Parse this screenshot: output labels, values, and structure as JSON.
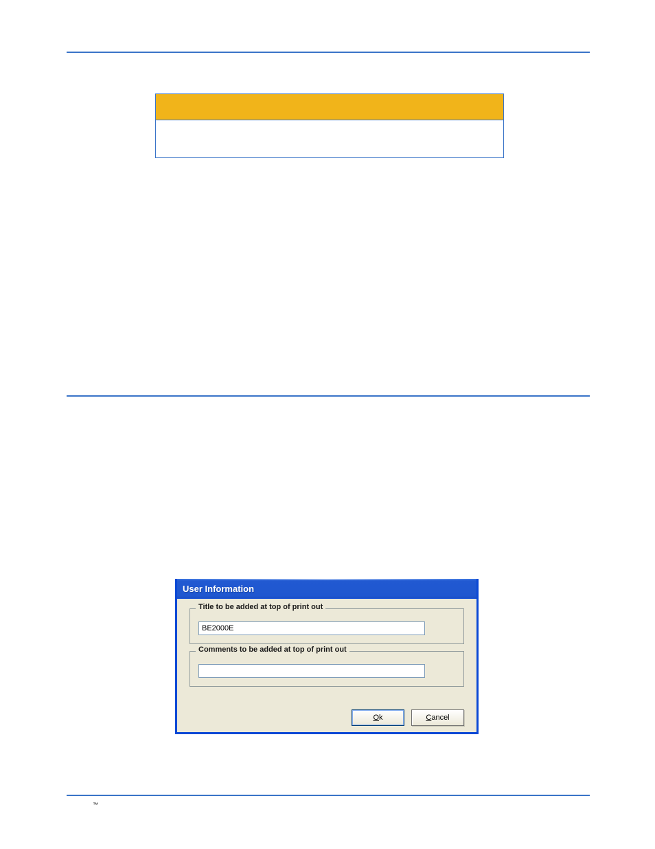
{
  "dialog": {
    "title": "User Information",
    "group1": {
      "legend": "Title to be added at top of print out",
      "value": "BE2000E"
    },
    "group2": {
      "legend": "Comments to be added at top of print out",
      "value": ""
    },
    "buttons": {
      "ok": {
        "accel": "O",
        "rest": "k"
      },
      "cancel": {
        "accel": "C",
        "rest": "ancel"
      }
    }
  },
  "footer_symbol": "™"
}
